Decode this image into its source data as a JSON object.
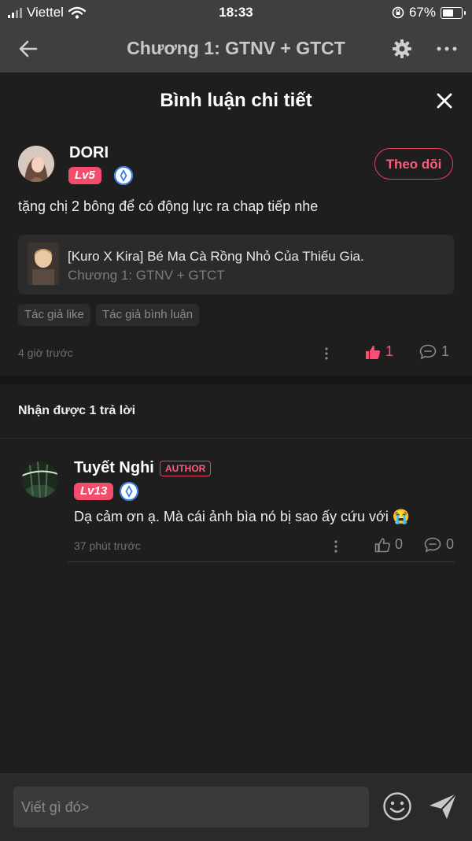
{
  "status_bar": {
    "carrier": "Viettel",
    "time": "18:33",
    "battery": "67%"
  },
  "nav": {
    "title": "Chương 1: GTNV + GTCT",
    "icons": [
      "back-arrow-icon",
      "gear-icon",
      "more-horizontal-icon"
    ]
  },
  "sheet": {
    "title": "Bình luận chi tiết"
  },
  "comment": {
    "username": "DORI",
    "level": "Lv5",
    "follow_label": "Theo dõi",
    "text": "tặng chị 2 bông để có động lực ra chap tiếp nhe",
    "book": {
      "title": "[Kuro X Kira] Bé Ma Cà Rồng Nhỏ Của Thiếu Gia.",
      "chapter": "Chương 1: GTNV + GTCT"
    },
    "tags": [
      "Tác giả like",
      "Tác giả bình luận"
    ],
    "time": "4 giờ trước",
    "likes": "1",
    "replies": "1"
  },
  "replies_header": "Nhận được 1 trả lời",
  "reply": {
    "username": "Tuyết Nghi",
    "author_tag": "AUTHOR",
    "level": "Lv13",
    "text": "Dạ cảm ơn ạ. Mà cái ảnh bìa nó bị sao ấy cứu với 😭",
    "time": "37 phút trước",
    "likes": "0",
    "replies": "0"
  },
  "input": {
    "placeholder": "Viết gì đó>"
  },
  "colors": {
    "accent": "#ee3f66",
    "level_badge": "#f44d6c",
    "background": "#1e1e1e",
    "header": "#3f3f3f"
  }
}
